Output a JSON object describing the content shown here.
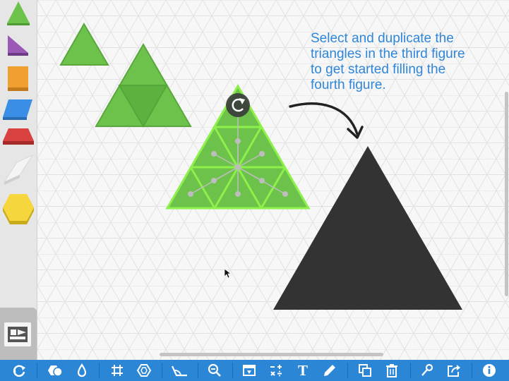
{
  "instruction": {
    "lines": [
      "Select and duplicate the",
      "triangles in the third figure",
      "to get started filling the",
      "fourth figure."
    ]
  },
  "sidebar": {
    "shapes": [
      {
        "name": "green-triangle",
        "color": "#6cc24a"
      },
      {
        "name": "purple-rhombus",
        "color": "#9b59b6"
      },
      {
        "name": "orange-square",
        "color": "#f0a030"
      },
      {
        "name": "blue-rhombus",
        "color": "#3a8ee6"
      },
      {
        "name": "red-trapezoid",
        "color": "#d94040"
      },
      {
        "name": "white-thin-rhombus",
        "color": "#f4f4f4"
      },
      {
        "name": "yellow-hexagon",
        "color": "#f5d63d"
      }
    ],
    "stage_button_icon": "stage-person-icon"
  },
  "toolbar": {
    "buttons": [
      {
        "icon": "refresh-icon",
        "glyph": "⟳"
      },
      {
        "icon": "shapes-icon",
        "glyph": ""
      },
      {
        "icon": "color-drop-icon",
        "glyph": ""
      },
      {
        "icon": "grid-icon",
        "glyph": "#"
      },
      {
        "icon": "hex-grid-icon",
        "glyph": ""
      },
      {
        "icon": "angle-icon",
        "glyph": ""
      },
      {
        "icon": "zoom-out-icon",
        "glyph": ""
      },
      {
        "icon": "image-icon",
        "glyph": ""
      },
      {
        "icon": "math-icon",
        "glyph": ""
      },
      {
        "icon": "text-icon",
        "glyph": "T"
      },
      {
        "icon": "pencil-icon",
        "glyph": ""
      },
      {
        "icon": "duplicate-icon",
        "glyph": ""
      },
      {
        "icon": "trash-icon",
        "glyph": ""
      },
      {
        "icon": "link-icon",
        "glyph": ""
      },
      {
        "icon": "share-icon",
        "glyph": ""
      },
      {
        "icon": "info-icon",
        "glyph": ""
      }
    ]
  },
  "colors": {
    "toolbar": "#2b86d6",
    "instruction_text": "#2f86d8",
    "triangle_green": "#6cc24a",
    "selected_outline": "#8ef04a",
    "target_figure": "#333333"
  }
}
